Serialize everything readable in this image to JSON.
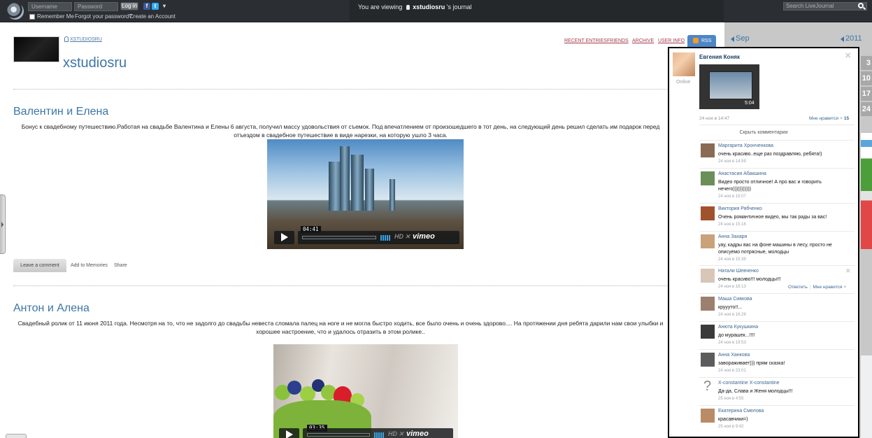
{
  "topbar": {
    "username_placeholder": "Username",
    "password_placeholder": "Password",
    "login_label": "Log in",
    "remember_me": "Remember Me",
    "forgot_password": "Forgot your password?",
    "create_account": "Create an Account",
    "viewing_prefix": "You are viewing",
    "viewing_user": "xstudiosru",
    "viewing_suffix": "'s journal",
    "search_placeholder": "Search LiveJournal",
    "facebook_glyph": "f",
    "twitter_glyph": "t",
    "dropdown_glyph": "▾"
  },
  "journal": {
    "user_link": "XSTUDIOSRU",
    "title": "xstudiosru",
    "nav": [
      "RECENT ENTRIES",
      "FRIENDS",
      "ARCHIVE",
      "USER INFO"
    ],
    "rss_label": "RSS"
  },
  "posts": [
    {
      "title": "Валентин и Елена",
      "text": "Бонус к свадебному путешествию.Работая на свадьбе Валентина и Елены 6 августа, получил массу удовольствия от съемок. Под впечатлением от произошедшего в тот день, на следующий день решил сделать им подарок перед отъездом в свадебное путешествие в виде нарезки, на которую ушло 3 часа.",
      "video_time": "04:41",
      "hd_label": "HD",
      "vimeo_label": "vimeo",
      "progress": 0
    },
    {
      "title": "Антон и Алена",
      "text": "Свадебный ролик от 11 июня 2011 года. Несмотря на то, что не задолго до свадьбы невеста сломала палец на ноге и не могла быстро ходить, все было очень и очень здорово.... На протяжении дня ребята дарили нам свои улыбки и хорошее настроение, что и удалось отразить в этом ролике..",
      "video_time": "03:35",
      "hd_label": "HD",
      "vimeo_label": "vimeo",
      "progress": 0
    }
  ],
  "post_footer": {
    "leave_comment": "Leave a comment",
    "add_to_memories": "Add to Memories",
    "share": "Share"
  },
  "calendar": {
    "month": "Sep",
    "year": "2011",
    "days": [
      "3",
      "10",
      "17",
      "24"
    ]
  },
  "popup": {
    "close_glyph": "✕",
    "author": "Евгения Коняк",
    "status": "Online",
    "video_time": "5:04",
    "post_date": "24 ноя в 14:47",
    "like_label": "Мне нравится",
    "like_count": "15",
    "hide_comments": "Скрыть комментарии",
    "reply_label": "Ответить",
    "comment_like_label": "Мне нравится",
    "comments": [
      {
        "name": "Маргарита Хронченкова",
        "text": "очень красиво..еще раз поздравляю, ребята!)",
        "date": "24 ноя в 14:59",
        "avatar_color": "#8a6a55"
      },
      {
        "name": "Анастасия Абакшина",
        "text": "Видео просто отличное! А про вас и говорить нечего)))))))))))",
        "date": "24 ноя в 15:07",
        "avatar_color": "#6b8f5a"
      },
      {
        "name": "Виктория Рябченко",
        "text": "Очень романтичное видео, мы так рады за вас!",
        "date": "24 ноя в 15:16",
        "avatar_color": "#a0522d"
      },
      {
        "name": "Анна Захаря",
        "text": "уау, кадры вас на фоне машины в лесу, просто не описуемо потрясные, молодцы",
        "date": "24 ноя в 15:39",
        "avatar_color": "#c9a27a"
      },
      {
        "name": "Натали Шевченко",
        "text": "очень красиво!!! молодцы!!!",
        "date": "24 ноя в 16:13",
        "avatar_color": "#d8c6b8"
      },
      {
        "name": "Маша Сивкова",
        "text": "круууто!!...",
        "date": "24 ноя в 16:28",
        "avatar_color": "#9c7f6e"
      },
      {
        "name": "Анюта Кукушкина",
        "text": "до мурашек...!!!!",
        "date": "24 ноя в 19:53",
        "avatar_color": "#3a3a3a"
      },
      {
        "name": "Анна Ханкова",
        "text": "завораживает))) прям сказка!",
        "date": "24 ноя в 23:01",
        "avatar_color": "#5c5c5c"
      },
      {
        "name": "X-constantine X-constantine",
        "text": "Да-да, Слава и Женя молодцы!!!",
        "date": "25 ноя в 4:55",
        "avatar_color": "#ffffff"
      },
      {
        "name": "Екатерина Смелова",
        "text": "красавчики=)",
        "date": "25 ноя в 9:42",
        "avatar_color": "#b98b66"
      }
    ]
  }
}
